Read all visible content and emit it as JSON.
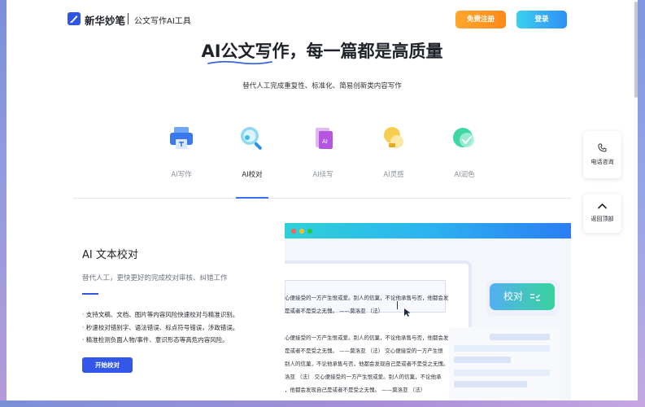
{
  "header": {
    "brand_name": "新华妙笔",
    "brand_tagline": "公文写作AI工具",
    "register_label": "免费注册",
    "login_label": "登录"
  },
  "hero": {
    "title": "AI公文写作，每一篇都是高质量",
    "subtitle": "替代人工完成重复性、标准化、简易创新类内容写作"
  },
  "tabs": [
    {
      "label": "AI写作",
      "icon": "printer-icon",
      "active": false
    },
    {
      "label": "AI校对",
      "icon": "magnifier-icon",
      "active": true
    },
    {
      "label": "AI续写",
      "icon": "document-ai-icon",
      "active": false
    },
    {
      "label": "AI灵感",
      "icon": "lightbulb-icon",
      "active": false
    },
    {
      "label": "AI润色",
      "icon": "check-badge-icon",
      "active": false
    }
  ],
  "feature": {
    "title": "AI 文本校对",
    "subtitle": "替代人工，更快更好的完成校对审核、纠错工作",
    "bullets": [
      "· 支持文稿、文档、图片等内容风险快速校对与精准识别。",
      "· 秒速校对错别字、语法错误、标点符号错误，涉政错误。",
      "· 精准检测负面人物/事件、意识形态等高危内容风险。"
    ],
    "start_label": "开始校对"
  },
  "illustration": {
    "doc_lines": [
      "心便接受的一方产生恨或爱。别人的信菓，不论他承售与否，他都会发",
      "是或者不是受之无愧。 ——莫洛亚 （法）",
      "心便接受的一方产生恨或爱。别人的信菓，不论他承售与否，他都会发",
      "是或者不是受之无愧。 ——莫洛亚 （法）    交心便接受的一方产生恨",
      "别人的信菓，不论他承售与否，他都会发现自己是或者不是受之无愧。",
      "洛亚 （法）    交心便接受的一方产生恨或爱。别人的信菓，不论他承",
      "，他都会发现自己是或者不是受之无愧。 ——莫洛亚 （法）"
    ],
    "check_label": "校对"
  },
  "float": {
    "phone_label": "电话咨询",
    "top_label": "返回顶部"
  },
  "colors": {
    "accent": "#3357e8",
    "register": "#ff962a",
    "login": "#2f9cf5"
  }
}
